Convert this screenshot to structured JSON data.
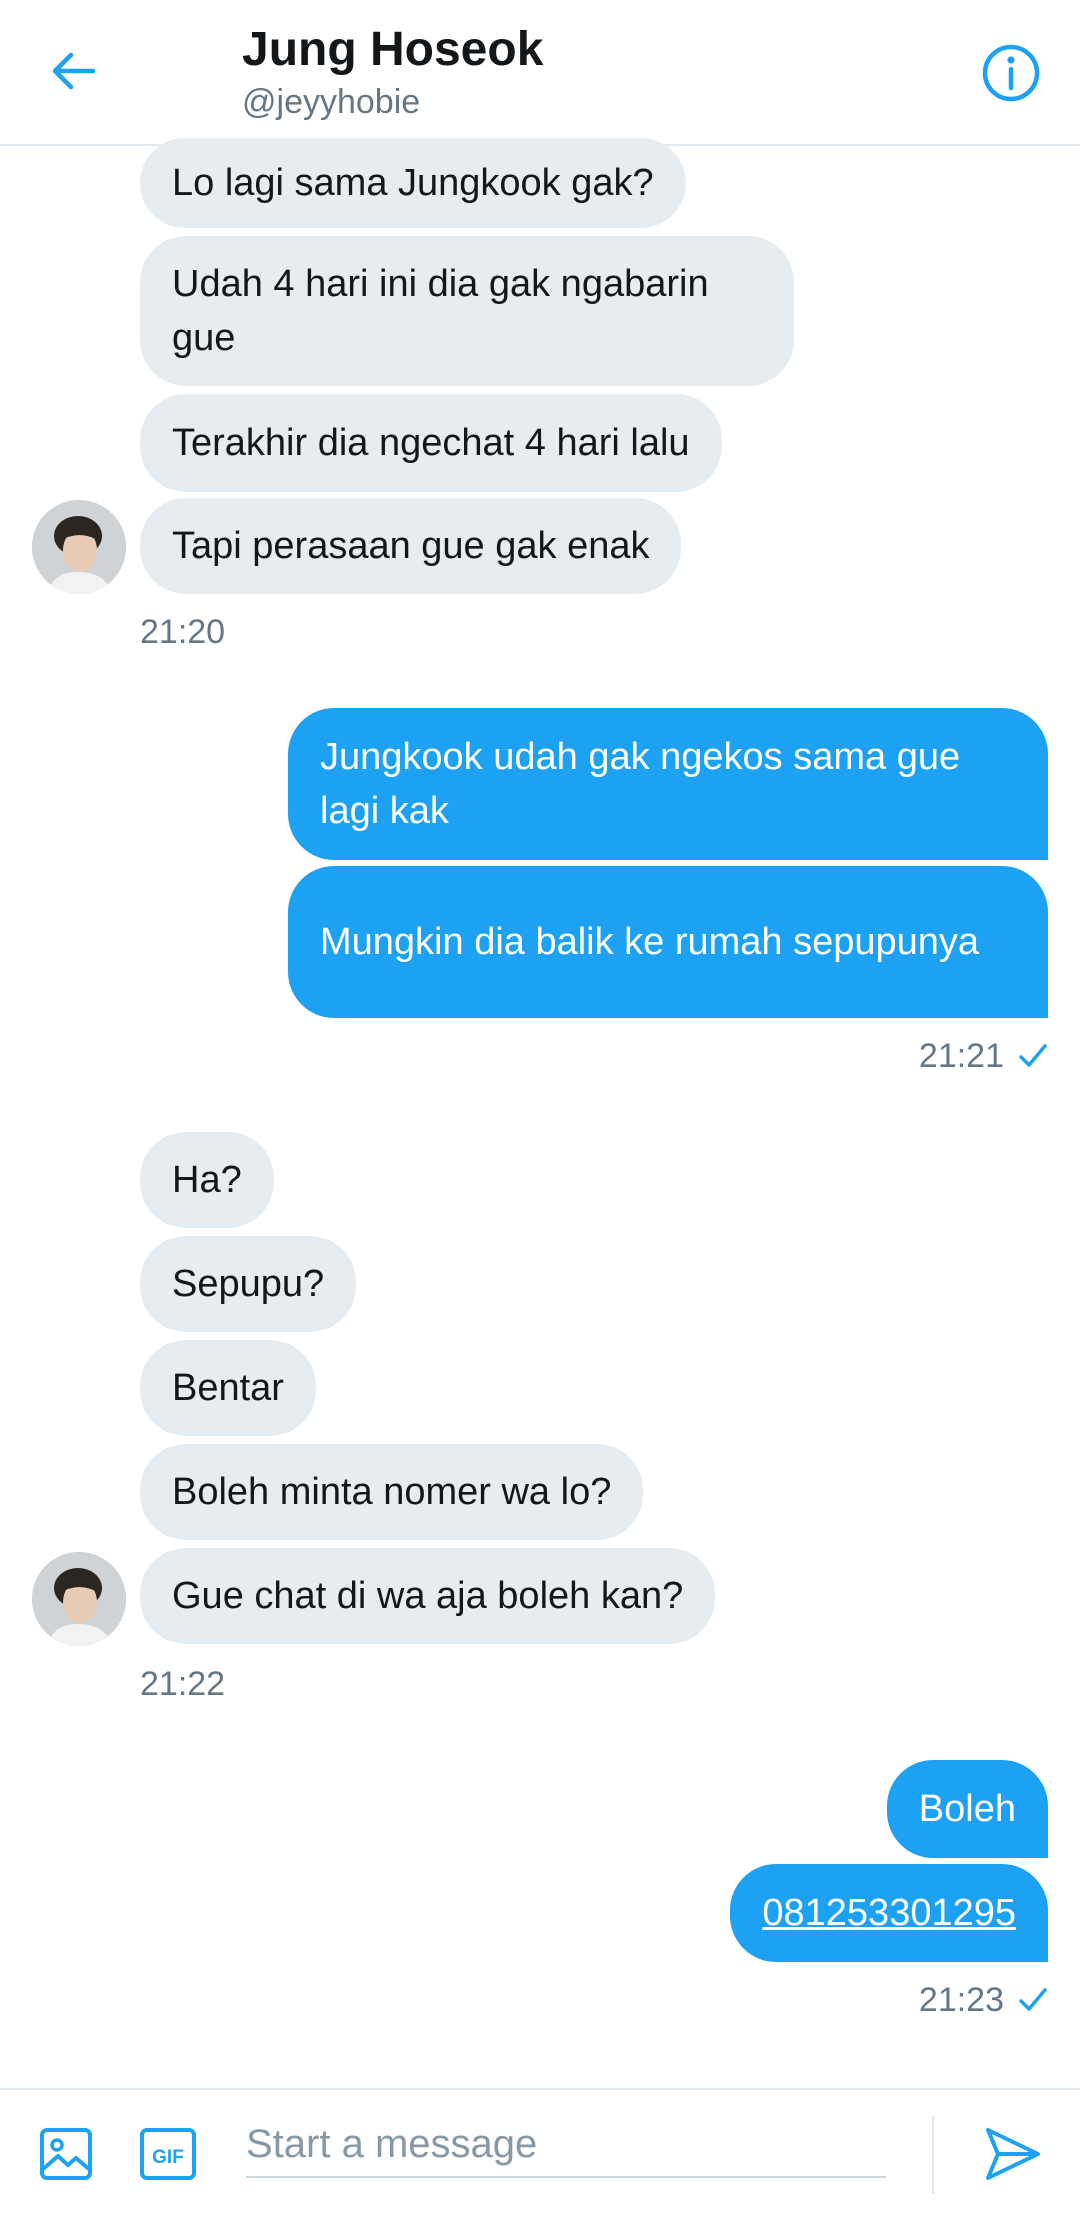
{
  "header": {
    "name": "Jung Hoseok",
    "handle": "@jeyyhobie"
  },
  "groups": [
    {
      "from": "them",
      "messages": [
        "Lo lagi sama Jungkook gak?",
        "Udah 4 hari ini dia gak ngabarin gue",
        "Terakhir dia ngechat 4 hari lalu",
        "Tapi perasaan gue gak enak"
      ],
      "time": "21:20"
    },
    {
      "from": "me",
      "messages": [
        "Jungkook udah gak ngekos sama gue lagi kak",
        "Mungkin dia balik ke rumah sepupunya"
      ],
      "time": "21:21",
      "status": "sent"
    },
    {
      "from": "them",
      "messages": [
        "Ha?",
        "Sepupu?",
        "Bentar",
        "Boleh minta nomer wa lo?",
        "Gue chat di wa aja boleh kan?"
      ],
      "time": "21:22"
    },
    {
      "from": "me",
      "messages": [
        "Boleh",
        "081253301295"
      ],
      "time": "21:23",
      "status": "sent"
    }
  ],
  "composer": {
    "placeholder": "Start a message",
    "value": "",
    "gif_label": "GIF"
  },
  "icons": {
    "back": "arrow-left-icon",
    "info": "info-icon",
    "image": "image-icon",
    "gif": "gif-icon",
    "send": "send-icon",
    "read": "check-icon"
  },
  "colors": {
    "accent": "#1da1f2",
    "incoming_bubble": "#e6ecf0",
    "secondary_text": "#657786"
  }
}
